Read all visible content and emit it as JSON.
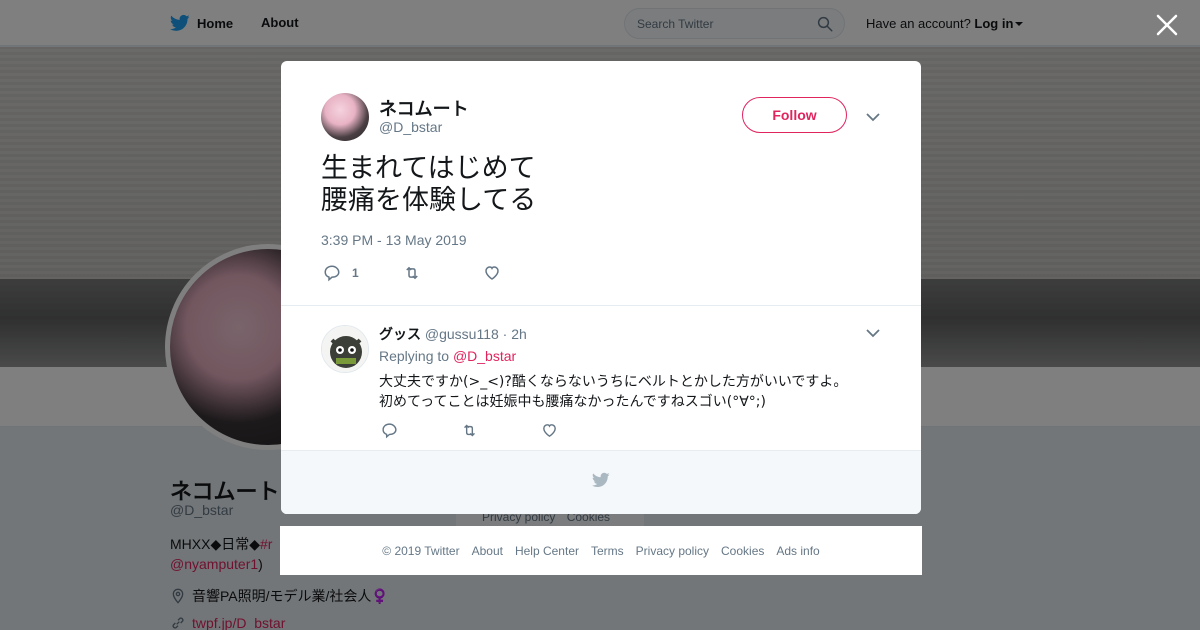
{
  "topbar": {
    "home_label": "Home",
    "about_label": "About",
    "search_placeholder": "Search Twitter",
    "account_prompt": "Have an account?",
    "login_label": "Log in"
  },
  "profile": {
    "name": "ネコムート",
    "handle": "@D_bstar",
    "bio_prefix": "MHXX◆日常◆",
    "bio_tag": "#r",
    "bio_mention": "@nyamputer1",
    "bio_suffix": ")",
    "location": "音響PA照明/モデル業/社会人♀️",
    "link": "twpf.jp/D_bstar",
    "footer_privacy": "Privacy policy",
    "footer_cookies": "Cookies"
  },
  "tweet": {
    "author_name": "ネコムート",
    "author_handle": "@D_bstar",
    "follow_label": "Follow",
    "text_line1": "生まれてはじめて",
    "text_line2": "腰痛を体験してる",
    "timestamp": "3:39 PM - 13 May 2019",
    "reply_count": "1"
  },
  "reply": {
    "author_name": "グッス",
    "author_handle": "@gussu118",
    "separator": " · ",
    "age": "2h",
    "replying_prefix": "Replying to ",
    "replying_to": "@D_bstar",
    "text_line1": "大丈夫ですか(>_<)?酷くならないうちにベルトとかした方がいいですよ。",
    "text_line2": "初めてってことは妊娠中も腰痛なかったんですねスゴい(°∀°;)"
  },
  "footer": {
    "copyright": "© 2019 Twitter",
    "about": "About",
    "help": "Help Center",
    "terms": "Terms",
    "privacy": "Privacy policy",
    "cookies": "Cookies",
    "ads": "Ads info"
  },
  "colors": {
    "accent": "#e0245e",
    "twitter_blue": "#1da1f2",
    "text_secondary": "#657786"
  },
  "icons": [
    "twitter-bird-icon",
    "search-icon",
    "close-icon",
    "chevron-down-icon",
    "reply-icon",
    "retweet-icon",
    "like-icon",
    "location-icon",
    "link-icon"
  ]
}
